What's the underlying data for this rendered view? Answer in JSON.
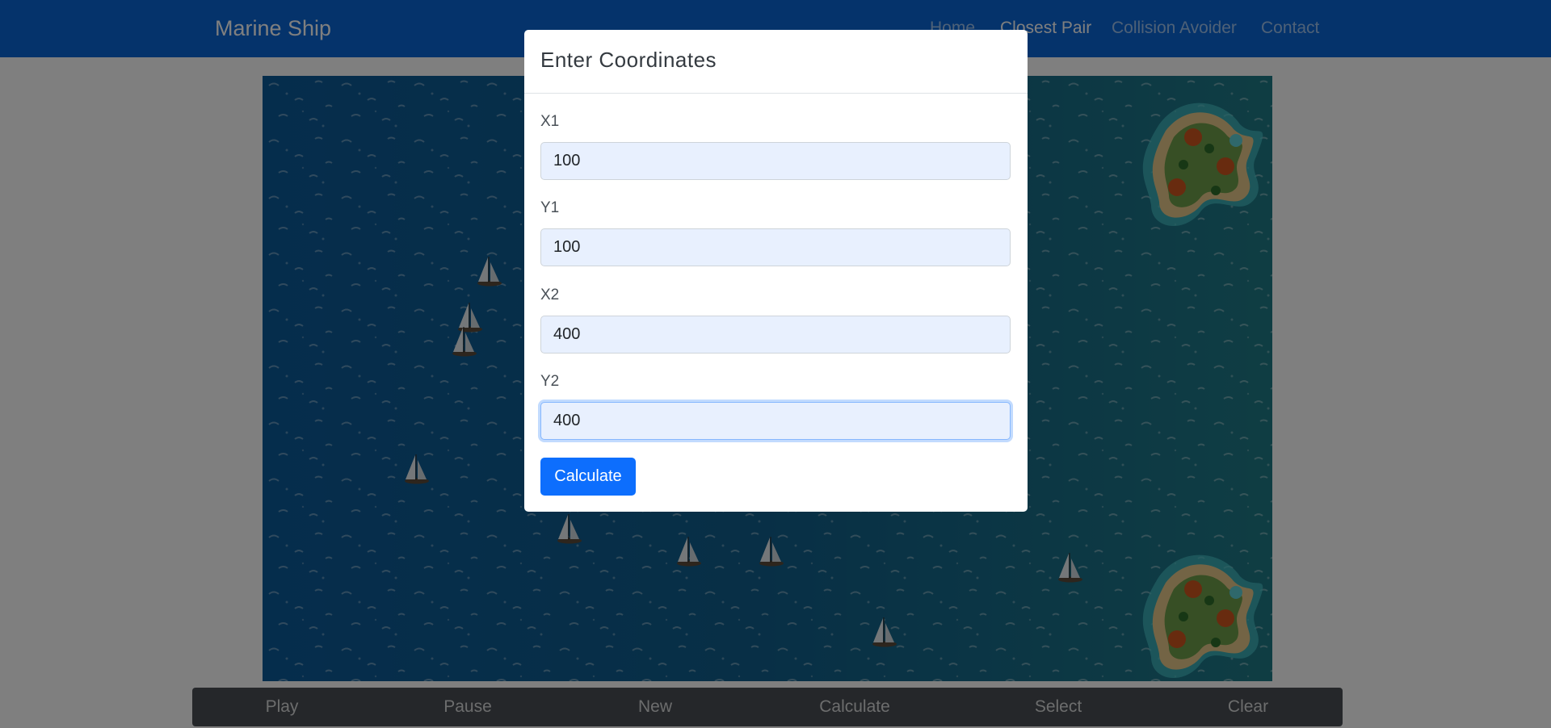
{
  "navbar": {
    "brand": "Marine Ship",
    "links": [
      {
        "label": "Home",
        "active": false
      },
      {
        "label": "Closest Pair",
        "active": true
      },
      {
        "label": "Collision Avoider",
        "active": false
      },
      {
        "label": "Contact",
        "active": false
      }
    ]
  },
  "toolbar": {
    "buttons": [
      "Play",
      "Pause",
      "New",
      "Calculate",
      "Select",
      "Clear"
    ]
  },
  "modal": {
    "title": "Enter Coordinates",
    "fields": [
      {
        "label": "X1",
        "value": "100"
      },
      {
        "label": "Y1",
        "value": "100"
      },
      {
        "label": "X2",
        "value": "400"
      },
      {
        "label": "Y2",
        "value": "400"
      }
    ],
    "submit_label": "Calculate"
  },
  "colors": {
    "navbar": "#0a66d6",
    "ocean_deep": "#0b5a99",
    "ocean_light": "#1d7a8c",
    "primary_button": "#0d6efd",
    "input_fill": "#e8f0fe"
  },
  "icons": {
    "ship": "sailboat-icon",
    "island": "tropical-island-icon"
  }
}
